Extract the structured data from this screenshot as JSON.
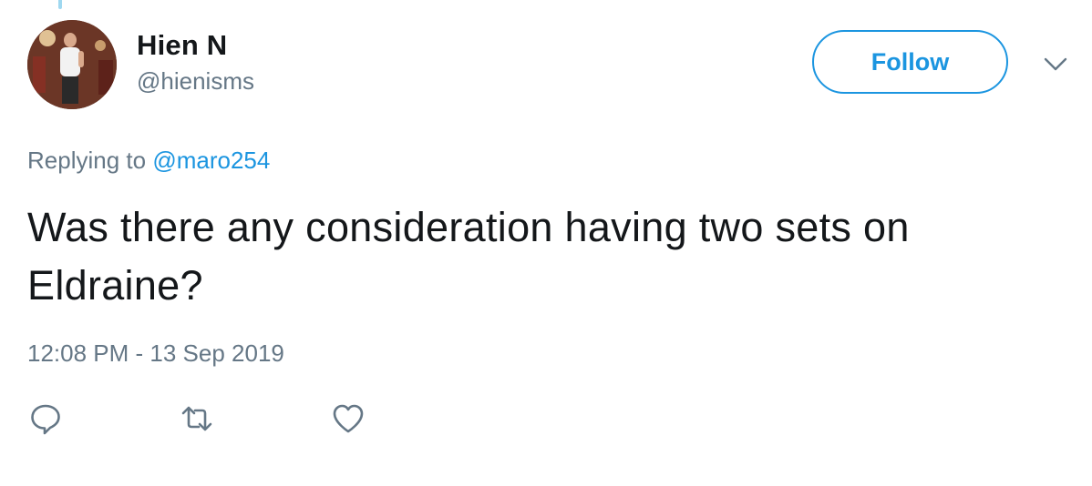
{
  "user": {
    "display_name": "Hien N",
    "username": "@hienisms",
    "avatar_icon": "user-avatar-photo"
  },
  "header": {
    "follow_label": "Follow",
    "more_icon": "chevron-down-icon"
  },
  "tweet": {
    "replying_prefix": "Replying to",
    "replying_to": "@maro254",
    "text": "Was there any consideration having two sets on Eldraine?",
    "timestamp": "12:08 PM - 13 Sep 2019"
  },
  "actions": {
    "reply_icon": "reply-icon",
    "retweet_icon": "retweet-icon",
    "like_icon": "heart-icon"
  },
  "colors": {
    "accent": "#1b95e0",
    "secondary_text": "#657786",
    "primary_text": "#14171a",
    "icon_gray": "#657786"
  }
}
